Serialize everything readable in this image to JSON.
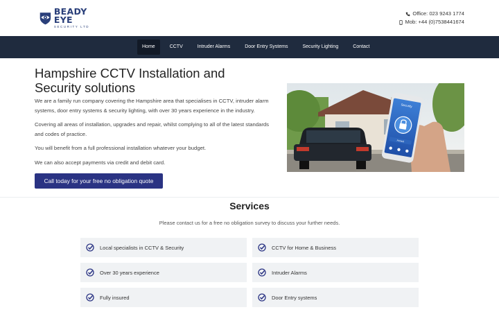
{
  "brand": {
    "name": "BEADY EYE",
    "tagline": "SECURITY LTD",
    "color": "#2a3f7a"
  },
  "contact": {
    "office": "Office: 023 9243 1774",
    "mobile": "Mob: +44 (0)7538441674"
  },
  "nav": {
    "items": [
      {
        "label": "Home",
        "active": true
      },
      {
        "label": "CCTV"
      },
      {
        "label": "Intruder Alarms"
      },
      {
        "label": "Door Entry Systems"
      },
      {
        "label": "Security Lighting"
      },
      {
        "label": "Contact"
      }
    ],
    "background": "#1f2b3e"
  },
  "hero": {
    "title": "Hampshire CCTV Installation and Security solutions",
    "paragraphs": [
      "We are a family run company covering the Hampshire area that specialises in CCTV, intruder alarm systems, door entry systems & security lighting, with over 30 years experience in the industry.",
      "Covering all areas of installation, upgrades and repair, whilst complying to all of the latest standards and codes of practice.",
      "You will benefit from a full professional installation whatever your budget.",
      "We can also accept payments via credit and debit card."
    ],
    "cta": "Call today for your free no obligation quote",
    "cta_color": "#2a3383",
    "image_phone_text": {
      "app_title": "Security",
      "status": "Armed"
    }
  },
  "services": {
    "title": "Services",
    "subtitle": "Please contact us for a free no obligation survey to discuss your further needs.",
    "items": [
      "Local specialists in CCTV & Security",
      "CCTV for Home & Business",
      "Over 30 years experience",
      "Intruder Alarms",
      "Fully insured",
      "Door Entry systems"
    ],
    "icon": "check-circle-icon"
  }
}
